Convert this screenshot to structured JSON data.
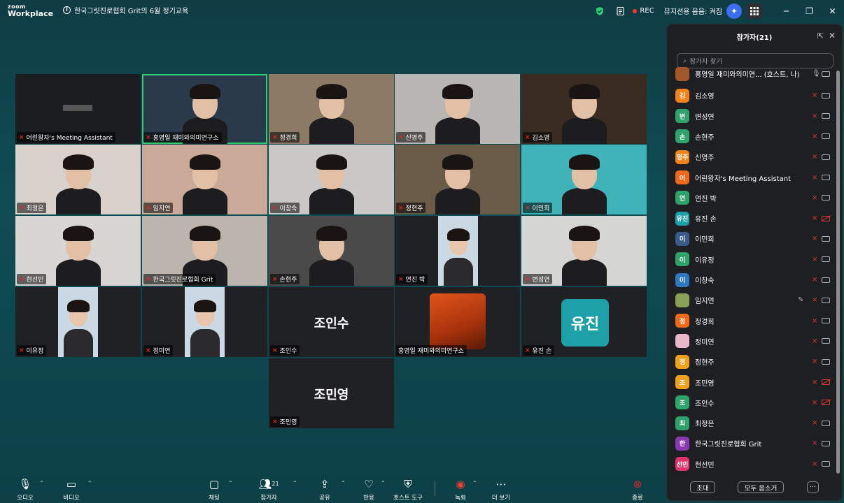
{
  "titlebar": {
    "logo_line1": "zoom",
    "logo_line2": "Workplace",
    "meeting_title": "한국그릿진로협회 Grit의 6월 정기교육",
    "rec_label": "REC",
    "music_label": "뮤지션용 음음: 켜짐"
  },
  "grid": {
    "tiles": [
      {
        "name": "어린왕자's Meeting Assistant",
        "bg": "#1c1d20"
      },
      {
        "name": "홍영일 재미와의미연구소",
        "bg": "#2a3a4a"
      },
      {
        "name": "정경희",
        "bg": "#8a7a66"
      },
      {
        "name": "신영주",
        "bg": "#b8b6b2"
      },
      {
        "name": "김소영",
        "bg": "#3a2c22"
      },
      {
        "name": "최정은",
        "bg": "#d9d2cc"
      },
      {
        "name": "임지연",
        "bg": "#caa998"
      },
      {
        "name": "이창숙",
        "bg": "#c9c8c6"
      },
      {
        "name": "정현주",
        "bg": "#6a5a48"
      },
      {
        "name": "이민희",
        "bg": "#3fb3b8"
      },
      {
        "name": "현선민",
        "bg": "#d8d6d3"
      },
      {
        "name": "한국그릿진로협회 Grit",
        "bg": "#bbb5ae"
      },
      {
        "name": "손현주",
        "bg": "#4a4a4a"
      },
      {
        "name": "연진 박",
        "bg": "#202124"
      },
      {
        "name": "변성연",
        "bg": "#d5d6d4"
      },
      {
        "name": "이유정",
        "bg": "#202124"
      },
      {
        "name": "정미연",
        "bg": "#202124"
      },
      {
        "name": "조인수",
        "bg": "#202124",
        "big": "조인수"
      },
      {
        "name": "홍영일 재미와의미연구소",
        "bg": "#202124"
      },
      {
        "name": "유진 손",
        "bg": "#202124",
        "big": "유진"
      },
      {
        "name": "조민영",
        "bg": "#202124",
        "big": "조민영"
      }
    ]
  },
  "panel": {
    "title": "참가자(21)",
    "search_placeholder": "참가자 찾기",
    "participants": [
      {
        "name": "홍영일 재미와의미연... (호스트, 나)",
        "avatar": "",
        "color": "#a4572a",
        "cam_off": false
      },
      {
        "name": "김소영",
        "avatar": "김",
        "color": "#f0841a",
        "cam_off": false
      },
      {
        "name": "변성연",
        "avatar": "변",
        "color": "#2ea36b",
        "cam_off": false
      },
      {
        "name": "손현주",
        "avatar": "손",
        "color": "#2ea36b",
        "cam_off": false
      },
      {
        "name": "신영주",
        "avatar": "영주",
        "color": "#f0841a",
        "cam_off": false
      },
      {
        "name": "어린왕자's Meeting Assistant",
        "avatar": "어",
        "color": "#f06a1a",
        "cam_off": false
      },
      {
        "name": "연진 박",
        "avatar": "연",
        "color": "#2ea36b",
        "cam_off": false
      },
      {
        "name": "유진 손",
        "avatar": "유진",
        "color": "#1ea0a8",
        "cam_off": true
      },
      {
        "name": "이민희",
        "avatar": "이",
        "color": "#3a5a8a",
        "cam_off": false
      },
      {
        "name": "이유정",
        "avatar": "이",
        "color": "#2ea36b",
        "cam_off": false
      },
      {
        "name": "이창숙",
        "avatar": "이",
        "color": "#2e78c0",
        "cam_off": false
      },
      {
        "name": "임지연",
        "avatar": "",
        "color": "#8aa055",
        "cam_off": false,
        "edit": true
      },
      {
        "name": "정경희",
        "avatar": "정",
        "color": "#f06a1a",
        "cam_off": false
      },
      {
        "name": "정미연",
        "avatar": "",
        "color": "#e8b8c8",
        "cam_off": false
      },
      {
        "name": "정현주",
        "avatar": "정",
        "color": "#f0a01a",
        "cam_off": false
      },
      {
        "name": "조민영",
        "avatar": "조",
        "color": "#f0a01a",
        "cam_off": true
      },
      {
        "name": "조인수",
        "avatar": "조",
        "color": "#2ea36b",
        "cam_off": true
      },
      {
        "name": "최정은",
        "avatar": "최",
        "color": "#2ea36b",
        "cam_off": false
      },
      {
        "name": "한국그릿진로협회 Grit",
        "avatar": "한",
        "color": "#8a3ab0",
        "cam_off": false
      },
      {
        "name": "현선민",
        "avatar": "선민",
        "color": "#e0336a",
        "cam_off": false
      }
    ],
    "invite_label": "초대",
    "mute_all_label": "모두 음소거",
    "more_label": "···"
  },
  "toolbar": {
    "audio": "오디오",
    "video": "비디오",
    "chat": "채팅",
    "participants": "참가자",
    "participants_count": "21",
    "share": "공유",
    "react": "반응",
    "host_tools": "호스트 도구",
    "record": "녹화",
    "more": "더 보기",
    "end": "종료"
  }
}
